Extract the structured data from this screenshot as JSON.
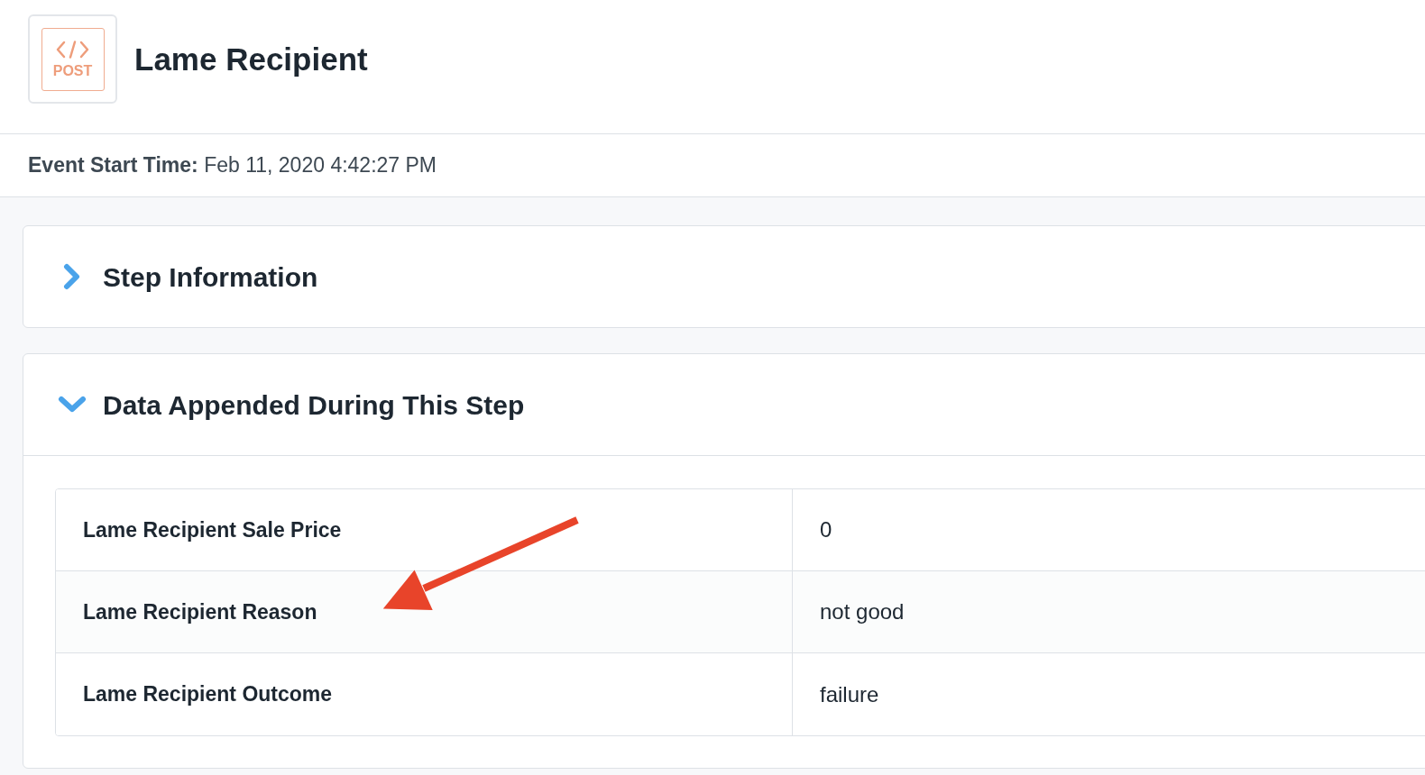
{
  "header": {
    "method_badge": {
      "label": "POST"
    },
    "title": "Lame Recipient"
  },
  "event_start": {
    "label": "Event Start Time:",
    "value": "Feb 11, 2020 4:42:27 PM"
  },
  "sections": [
    {
      "title": "Step Information",
      "expanded": false
    },
    {
      "title": "Data Appended During This Step",
      "expanded": true,
      "table": {
        "rows": [
          {
            "field": "Lame Recipient Sale Price",
            "value": "0"
          },
          {
            "field": "Lame Recipient Reason",
            "value": "not good"
          },
          {
            "field": "Lame Recipient Outcome",
            "value": "failure"
          }
        ]
      }
    }
  ]
}
